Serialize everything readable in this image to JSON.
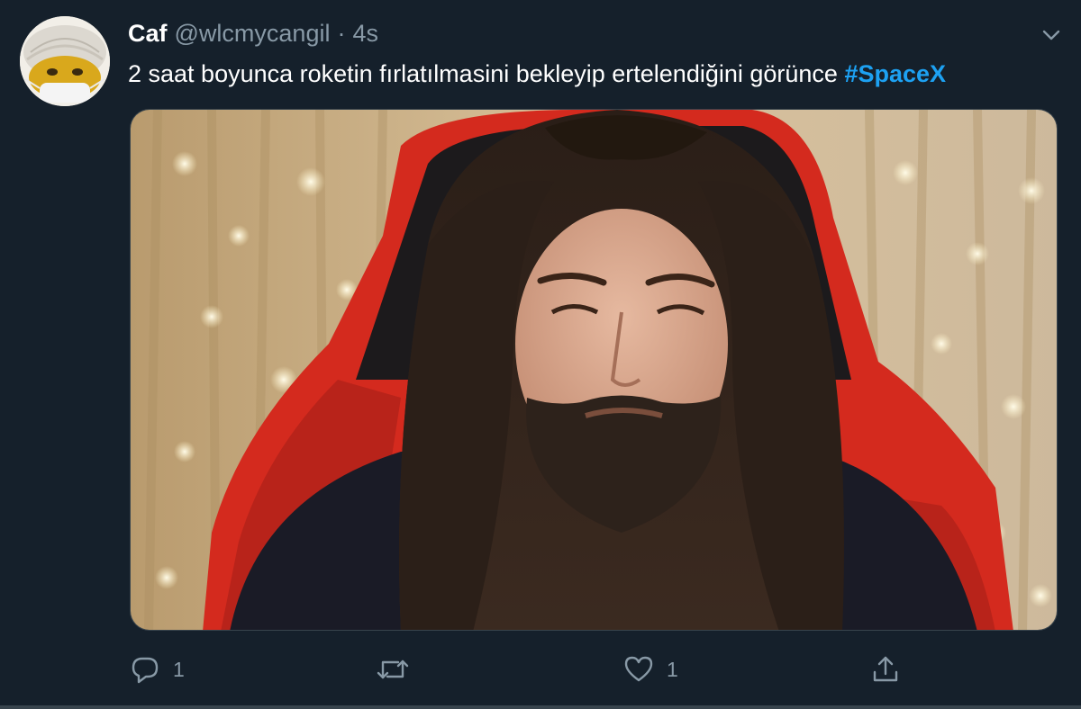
{
  "tweet": {
    "display_name": "Caf",
    "handle": "@wlcmycangil",
    "separator": "·",
    "time": "4s",
    "text": "2 saat boyunca roketin fırlatılmasini bekleyip ertelendiğini görünce",
    "hashtag": "#SpaceX"
  },
  "actions": {
    "reply_count": "1",
    "retweet_count": "",
    "like_count": "1"
  },
  "icons": {
    "caret": "chevron-down-icon",
    "reply": "reply-icon",
    "retweet": "retweet-icon",
    "like": "heart-icon",
    "share": "share-icon"
  },
  "colors": {
    "background": "#15202b",
    "secondary_text": "#8899a6",
    "hashtag": "#1da1f2",
    "chair_red": "#d42a1e"
  }
}
